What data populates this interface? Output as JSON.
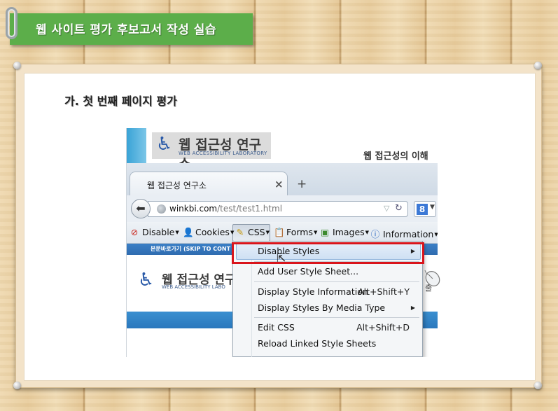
{
  "slide": {
    "banner_title": "웹 사이트 평가 후보고서 작성 실습",
    "section_heading": "가. 첫 번째 페이지 평가"
  },
  "site_header": {
    "logo_text": "웹 접근성 연구소",
    "logo_sub": "WEB ACCESSIBILITY LABORATORY",
    "intro": "웹 접근성의 이해"
  },
  "browser": {
    "tab_title": "웹 접근성 연구소",
    "tab_close": "×",
    "new_tab": "+",
    "url_host": "winkbi.com",
    "url_path": "/test/test1.html",
    "search_engine_letter": "8"
  },
  "toolbar": {
    "items": [
      {
        "label": "Disable",
        "icon": "disable-icon"
      },
      {
        "label": "Cookies",
        "icon": "cookies-icon"
      },
      {
        "label": "CSS",
        "icon": "css-pencil-icon"
      },
      {
        "label": "Forms",
        "icon": "forms-icon"
      },
      {
        "label": "Images",
        "icon": "images-icon"
      },
      {
        "label": "Information",
        "icon": "information-icon"
      }
    ]
  },
  "site_body": {
    "skip_link": "본문바로가기 (SKIP TO CONT",
    "logo_text": "웹 접근성 연구",
    "logo_sub": "WEB ACCESSIBILITY LABO",
    "side_text": "출"
  },
  "css_menu": {
    "items": [
      {
        "label": "Disable Styles",
        "shortcut": "",
        "submenu": true,
        "highlighted": true
      },
      {
        "label": "Add User Style Sheet...",
        "shortcut": "",
        "submenu": false
      },
      {
        "label": "Display Style Information",
        "shortcut": "Alt+Shift+Y",
        "submenu": false
      },
      {
        "label": "Display Styles By Media Type",
        "shortcut": "",
        "submenu": true
      },
      {
        "label": "Edit CSS",
        "shortcut": "Alt+Shift+D",
        "submenu": false
      },
      {
        "label": "Reload Linked Style Sheets",
        "shortcut": "",
        "submenu": false
      }
    ]
  },
  "colors": {
    "banner": "#5cae4a",
    "highlight_border": "#d9141b",
    "site_blue": "#2a78bd"
  }
}
